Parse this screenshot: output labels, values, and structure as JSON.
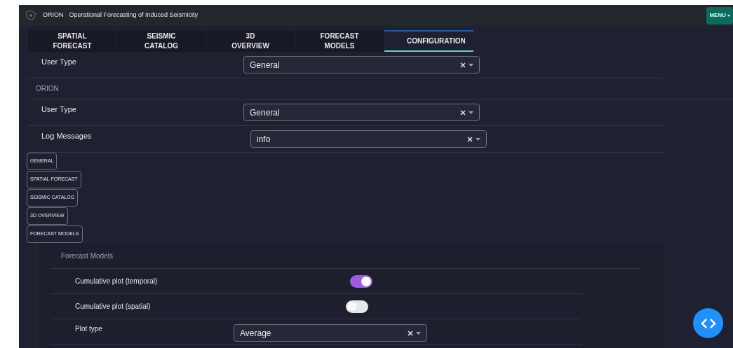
{
  "header": {
    "app_name": "ORION",
    "subtitle": "Operational Forecasting of Induced Seismicity",
    "menu_button": "MENU"
  },
  "tabs": [
    {
      "label": "SPATIAL FORECAST",
      "selected": false
    },
    {
      "label": "SEISMIC CATALOG",
      "selected": false
    },
    {
      "label": "3D OVERVIEW",
      "selected": false
    },
    {
      "label": "FORECAST MODELS",
      "selected": false
    },
    {
      "label": "CONFIGURATION",
      "selected": true
    }
  ],
  "top_row": {
    "label": "User Type",
    "value": "General"
  },
  "orion_section": {
    "title": "ORION",
    "rows": [
      {
        "label": "User Type",
        "value": "General"
      },
      {
        "label": "Log Messages",
        "value": "info"
      }
    ]
  },
  "section_buttons": [
    "GENERAL",
    "SPATIAL FORECAST",
    "SEISMIC CATALOG",
    "3D OVERVIEW",
    "FORECAST MODELS"
  ],
  "forecast_models": {
    "title": "Forecast Models",
    "rows": [
      {
        "kind": "toggle",
        "label": "Cumulative plot (temporal)",
        "on": true
      },
      {
        "kind": "toggle",
        "label": "Cumulative plot (spatial)",
        "on": false
      },
      {
        "kind": "select",
        "label": "Plot type",
        "value": "Average"
      }
    ]
  }
}
